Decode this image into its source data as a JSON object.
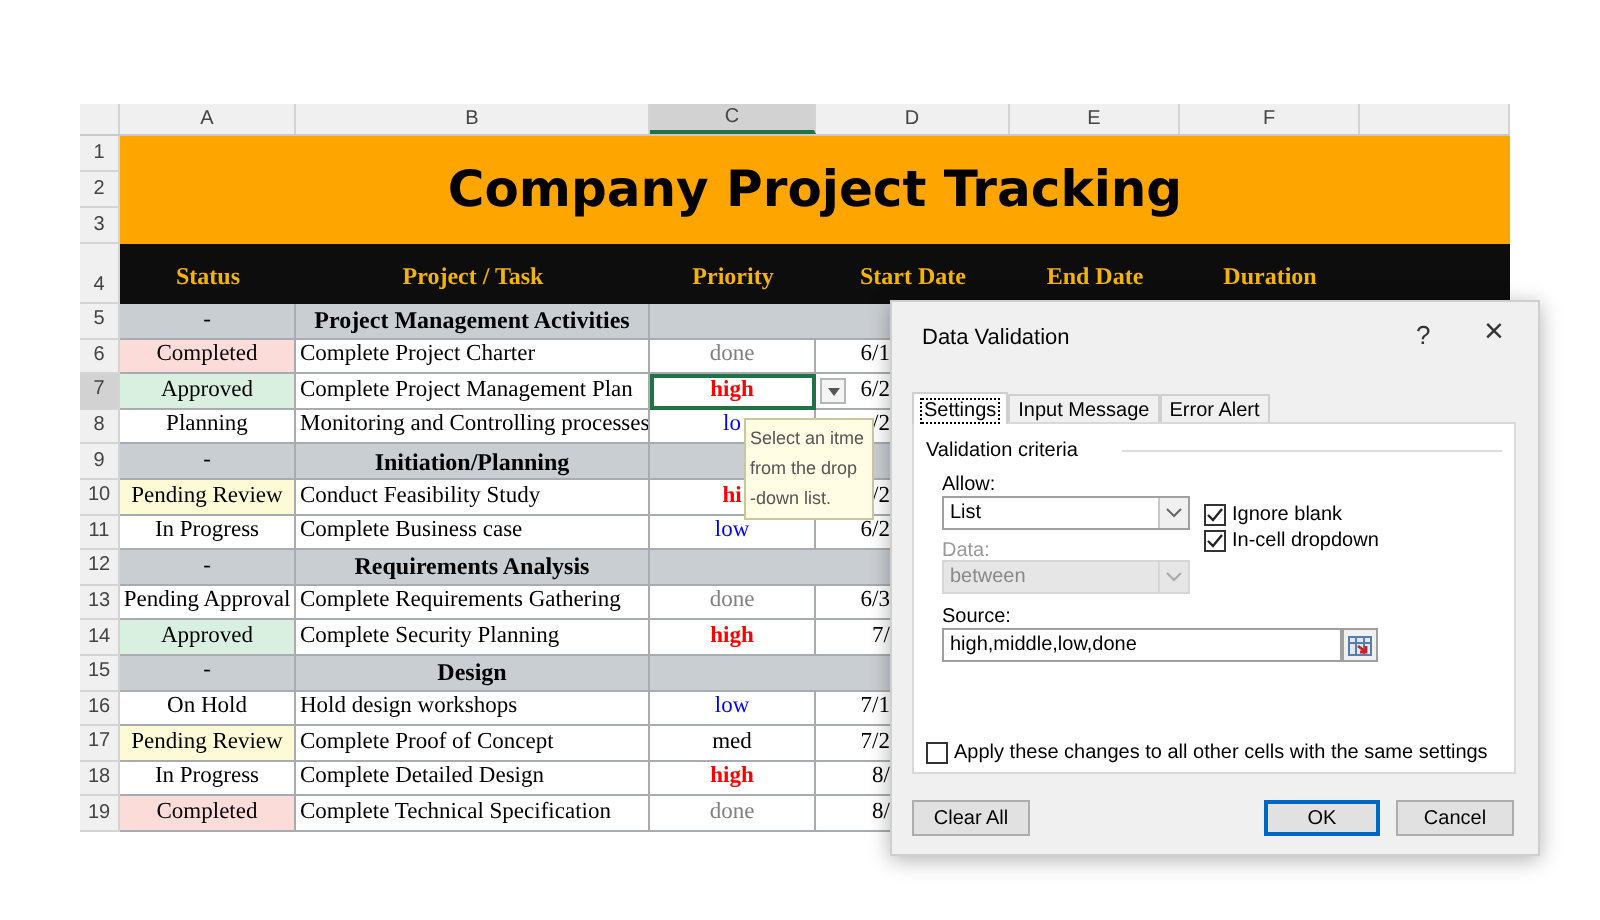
{
  "sheet": {
    "columns": [
      {
        "label": "A",
        "selected": false
      },
      {
        "label": "B",
        "selected": false
      },
      {
        "label": "C",
        "selected": true
      },
      {
        "label": "D",
        "selected": false
      },
      {
        "label": "E",
        "selected": false
      },
      {
        "label": "F",
        "selected": false
      }
    ],
    "title_rows": [
      "1",
      "2",
      "3"
    ],
    "title": "Company Project Tracking",
    "header_row": {
      "number": "4",
      "labels": [
        "Status",
        "Project / Task",
        "Priority",
        "Start Date",
        "End Date",
        "Duration"
      ]
    },
    "rows": [
      {
        "number": "5",
        "kind": "section",
        "status": "-",
        "task": "Project Management Activities",
        "selected": false
      },
      {
        "number": "6",
        "kind": "task",
        "status": "Completed",
        "color": "#fcdcd9",
        "task": "Complete Project Charter",
        "priority": {
          "text": "done",
          "color": "#808080",
          "bold": false
        },
        "start": "6/1",
        "selected": false
      },
      {
        "number": "7",
        "kind": "task",
        "status": "Approved",
        "color": "#d9efdf",
        "task": "Complete Project Management Plan",
        "priority": {
          "text": "high",
          "color": "#ff0000",
          "bold": true
        },
        "start": "6/2",
        "selected": true
      },
      {
        "number": "8",
        "kind": "task",
        "status": "Planning",
        "color": "#ffffff",
        "task": "Monitoring and Controlling processes",
        "priority": {
          "text": "lo",
          "color": "#0000ff",
          "bold": false
        },
        "start": "/2",
        "selected": false
      },
      {
        "number": "9",
        "kind": "section",
        "status": "-",
        "task": "Initiation/Planning",
        "selected": false
      },
      {
        "number": "10",
        "kind": "task",
        "status": "Pending Review",
        "color": "#fdfbd6",
        "task": "Conduct Feasibility Study",
        "priority": {
          "text": "hi",
          "color": "#ff0000",
          "bold": true
        },
        "start": "/2",
        "selected": false
      },
      {
        "number": "11",
        "kind": "task",
        "status": "In Progress",
        "color": "#ffffff",
        "task": "Complete Business case",
        "priority": {
          "text": "low",
          "color": "#0000ff",
          "bold": false
        },
        "start": "6/2",
        "selected": false
      },
      {
        "number": "12",
        "kind": "section",
        "status": "-",
        "task": "Requirements Analysis",
        "selected": false
      },
      {
        "number": "13",
        "kind": "task",
        "status": "Pending Approval",
        "color": "#ffffff",
        "task": "Complete Requirements Gathering",
        "priority": {
          "text": "done",
          "color": "#808080",
          "bold": false
        },
        "start": "6/3",
        "selected": false
      },
      {
        "number": "14",
        "kind": "task",
        "status": "Approved",
        "color": "#d9efdf",
        "task": "Complete Security Planning",
        "priority": {
          "text": "high",
          "color": "#ff0000",
          "bold": true
        },
        "start": "7/",
        "selected": false
      },
      {
        "number": "15",
        "kind": "section",
        "status": "-",
        "task": "Design",
        "selected": false
      },
      {
        "number": "16",
        "kind": "task",
        "status": "On Hold",
        "color": "#ffffff",
        "task": "Hold design workshops",
        "priority": {
          "text": "low",
          "color": "#0000ff",
          "bold": false
        },
        "start": "7/1",
        "selected": false
      },
      {
        "number": "17",
        "kind": "task",
        "status": "Pending Review",
        "color": "#fdfbd6",
        "task": "Complete Proof of Concept",
        "priority": {
          "text": "med",
          "color": "#000000",
          "bold": false
        },
        "start": "7/2",
        "selected": false
      },
      {
        "number": "18",
        "kind": "task",
        "status": "In Progress",
        "color": "#ffffff",
        "task": "Complete Detailed Design",
        "priority": {
          "text": "high",
          "color": "#ff0000",
          "bold": true
        },
        "start": "8/",
        "selected": false
      },
      {
        "number": "19",
        "kind": "task",
        "status": "Completed",
        "color": "#fcdcd9",
        "task": "Complete Technical Specification",
        "priority": {
          "text": "done",
          "color": "#808080",
          "bold": false
        },
        "start": "8/",
        "selected": false
      }
    ]
  },
  "tooltip": "Select an itme from the drop -down list.",
  "dialog": {
    "title": "Data Validation",
    "help": "?",
    "close": "×",
    "tabs": [
      {
        "label": "Settings",
        "selected": true
      },
      {
        "label": "Input Message",
        "selected": false
      },
      {
        "label": "Error Alert",
        "selected": false
      }
    ],
    "group_label": "Validation criteria",
    "allow": {
      "label": "Allow:",
      "value": "List"
    },
    "ignore_blank": {
      "label": "Ignore blank",
      "checked": true
    },
    "in_cell_dropdown": {
      "label": "In-cell dropdown",
      "checked": true
    },
    "data": {
      "label": "Data:",
      "value": "between",
      "disabled": true
    },
    "source": {
      "label": "Source:",
      "value": "high,middle,low,done"
    },
    "apply_all": {
      "label": "Apply these changes to all other cells with the same settings",
      "checked": false
    },
    "buttons": [
      {
        "label": "Clear All",
        "default": false
      },
      {
        "label": "OK",
        "default": true
      },
      {
        "label": "Cancel",
        "default": false
      }
    ]
  }
}
